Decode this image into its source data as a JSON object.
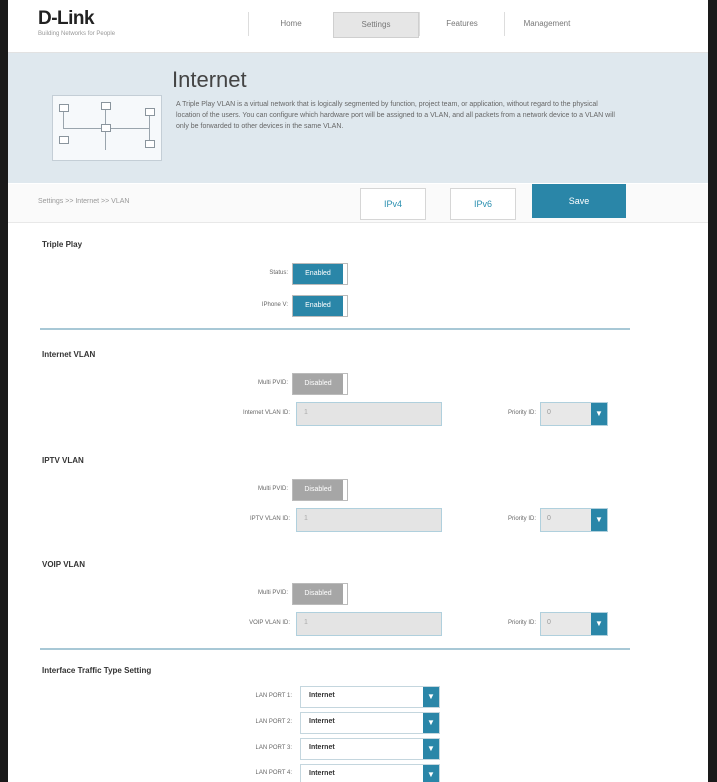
{
  "header": {
    "logo": "D-Link",
    "tagline": "Building Networks for People",
    "nav": [
      "Home",
      "Settings",
      "Features",
      "Management"
    ],
    "active_nav": 1
  },
  "banner": {
    "title": "Internet",
    "description": "A Triple Play VLAN is a virtual network that is logically segmented by function, project team, or application, without regard to the physical location of the users. You can configure which hardware port will be assigned to a VLAN, and all packets from a network device to a VLAN will only be forwarded to other devices in the same VLAN."
  },
  "tabs": {
    "breadcrumb": "Settings >> Internet >> VLAN",
    "ipv4": "IPv4",
    "ipv6": "IPv6",
    "save": "Save"
  },
  "triple_play": {
    "title": "Triple Play",
    "status_label": "Status:",
    "status_value": "Enabled",
    "iphone_label": "IPhone V:",
    "iphone_value": "Enabled"
  },
  "internet_vlan": {
    "title": "Internet VLAN",
    "multi_label": "Multi PVID:",
    "multi_value": "Disabled",
    "vid_label": "Internet VLAN ID:",
    "vid_value": "1",
    "priority_label": "Priority ID:",
    "priority_value": "0"
  },
  "iptv_vlan": {
    "title": "IPTV VLAN",
    "multi_label": "Multi PVID:",
    "multi_value": "Disabled",
    "vid_label": "IPTV VLAN ID:",
    "vid_value": "1",
    "priority_label": "Priority ID:",
    "priority_value": "0"
  },
  "voip_vlan": {
    "title": "VOIP VLAN",
    "multi_label": "Multi PVID:",
    "multi_value": "Disabled",
    "vid_label": "VOIP VLAN ID:",
    "vid_value": "1",
    "priority_label": "Priority ID:",
    "priority_value": "0"
  },
  "interface": {
    "title": "Interface Traffic Type Setting",
    "ports": [
      {
        "label": "LAN PORT 1:",
        "value": "Internet"
      },
      {
        "label": "LAN PORT 2:",
        "value": "Internet"
      },
      {
        "label": "LAN PORT 3:",
        "value": "Internet"
      },
      {
        "label": "LAN PORT 4:",
        "value": "Internet"
      }
    ]
  },
  "colors": {
    "accent": "#2a86a8",
    "banner_bg": "#dfe8ee",
    "disabled": "#a6a6a6"
  },
  "icons": {
    "dropdown": "chevron-down-icon"
  }
}
